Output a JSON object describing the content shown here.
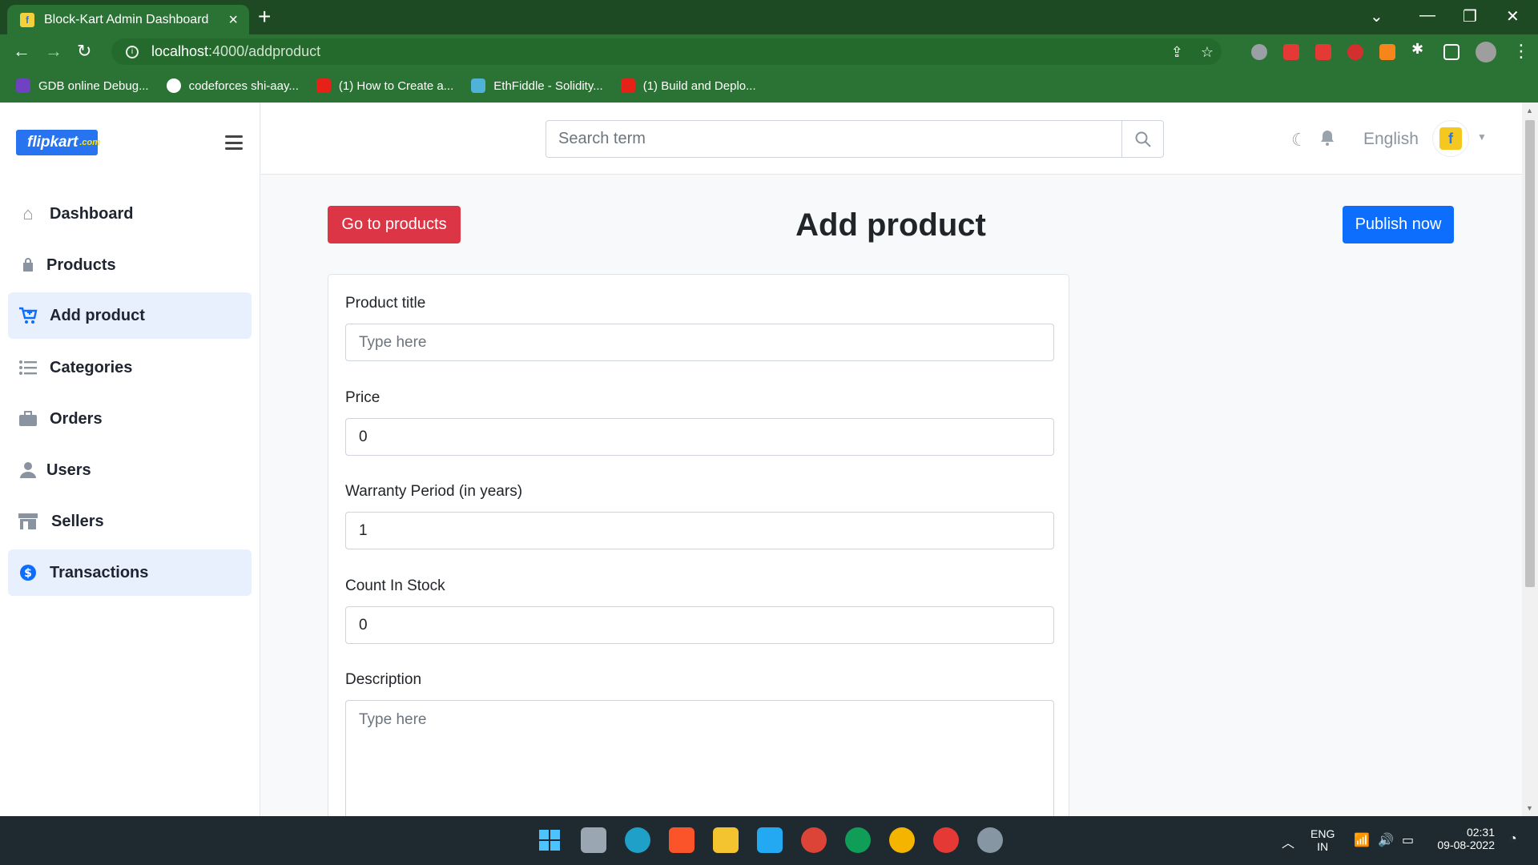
{
  "browser": {
    "tab_title": "Block-Kart Admin Dashboard",
    "url_host": "localhost",
    "url_path": ":4000/addproduct",
    "bookmarks": [
      {
        "label": "GDB online Debug...",
        "color": "#6f42c1"
      },
      {
        "label": "codeforces shi-aay...",
        "color": "#ffffff"
      },
      {
        "label": "(1) How to Create a...",
        "color": "#e62117"
      },
      {
        "label": "EthFiddle - Solidity...",
        "color": "#4fb3d9"
      },
      {
        "label": "(1) Build and Deplo...",
        "color": "#e62117"
      }
    ]
  },
  "sidebar": {
    "logo_text": "flipkart",
    "logo_tag": ".com",
    "items": [
      {
        "label": "Dashboard",
        "icon": "home-icon",
        "active": false
      },
      {
        "label": "Products",
        "icon": "shopping-bag-icon",
        "active": false
      },
      {
        "label": "Add product",
        "icon": "cart-plus-icon",
        "active": true
      },
      {
        "label": "Categories",
        "icon": "list-icon",
        "active": false
      },
      {
        "label": "Orders",
        "icon": "briefcase-icon",
        "active": false
      },
      {
        "label": "Users",
        "icon": "user-icon",
        "active": false
      },
      {
        "label": "Sellers",
        "icon": "store-icon",
        "active": false
      },
      {
        "label": "Transactions",
        "icon": "dollar-icon",
        "active": true
      }
    ]
  },
  "topbar": {
    "search_placeholder": "Search term",
    "language": "English"
  },
  "page": {
    "back_button": "Go to products",
    "title": "Add product",
    "publish_button": "Publish now"
  },
  "form": {
    "product_title_label": "Product title",
    "product_title_placeholder": "Type here",
    "price_label": "Price",
    "price_value": "0",
    "warranty_label": "Warranty Period (in years)",
    "warranty_value": "1",
    "stock_label": "Count In Stock",
    "stock_value": "0",
    "description_label": "Description",
    "description_placeholder": "Type here"
  },
  "taskbar": {
    "lang_top": "ENG",
    "lang_bottom": "IN",
    "time": "02:31",
    "date": "09-08-2022"
  },
  "colors": {
    "primary": "#0d6efd",
    "danger": "#dc3545",
    "chrome_green": "#2b7334"
  }
}
